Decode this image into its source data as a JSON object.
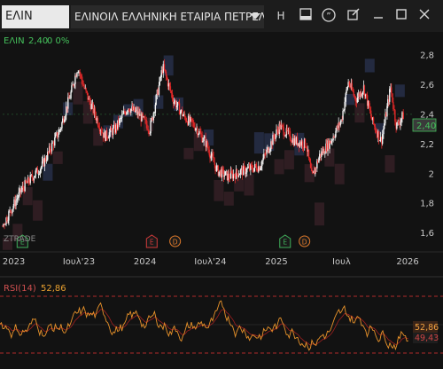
{
  "toolbar": {
    "symbol": "ΕΛΙΝ",
    "company_name": "ΕΛΙΝΟΙΛ ΕΛΛΗΝΙΚΗ ΕΤΑΙΡΙΑ ΠΕΤΡΕΛΑΙΩ",
    "h_label": "H"
  },
  "price_panel": {
    "legend_symbol": "ΕΛΙΝ",
    "legend_value": "2,40",
    "legend_change": "0 0%",
    "last_price_badge": "2,40",
    "watermark": "ZTRADE",
    "event_markers": [
      {
        "date": "2023-01-25",
        "letter": "E",
        "color": "#3fae5a"
      },
      {
        "date": "2024-01-20",
        "letter": "E",
        "color": "#d03a3a"
      },
      {
        "date": "2024-03-25",
        "letter": "D",
        "color": "#e07a2a"
      },
      {
        "date": "2025-01-25",
        "letter": "E",
        "color": "#3fae5a"
      },
      {
        "date": "2025-03-20",
        "letter": "D",
        "color": "#e07a2a"
      }
    ]
  },
  "rsi_panel": {
    "label": "RSI(14)",
    "value": "52,86",
    "badge_top": "52,86",
    "badge_bottom": "49,43",
    "upper_level": 70,
    "lower_level": 30
  },
  "chart_data": [
    {
      "type": "candlestick",
      "y_axis_ticks": [
        "2,8",
        "2,6",
        "2,4",
        "2,2",
        "2",
        "1,8",
        "1,6"
      ],
      "x_axis_ticks": [
        "2023",
        "Ιουλ'23",
        "2024",
        "Ιουλ'24",
        "2025",
        "Ιουλ",
        "2026"
      ],
      "ylim": [
        1.52,
        2.92
      ],
      "x_range": [
        "2022-12-01",
        "2025-12-22"
      ],
      "close_keypoints": [
        {
          "date": "2022-12-01",
          "value": 1.65
        },
        {
          "date": "2023-01-25",
          "value": 1.9
        },
        {
          "date": "2023-03-20",
          "value": 2.05
        },
        {
          "date": "2023-05-10",
          "value": 2.3
        },
        {
          "date": "2023-06-10",
          "value": 2.55
        },
        {
          "date": "2023-06-28",
          "value": 2.72
        },
        {
          "date": "2023-07-20",
          "value": 2.55
        },
        {
          "date": "2023-08-15",
          "value": 2.4
        },
        {
          "date": "2023-09-10",
          "value": 2.25
        },
        {
          "date": "2023-10-10",
          "value": 2.3
        },
        {
          "date": "2023-11-15",
          "value": 2.45
        },
        {
          "date": "2023-12-15",
          "value": 2.4
        },
        {
          "date": "2024-01-15",
          "value": 2.3
        },
        {
          "date": "2024-02-20",
          "value": 2.72
        },
        {
          "date": "2024-03-20",
          "value": 2.5
        },
        {
          "date": "2024-04-20",
          "value": 2.38
        },
        {
          "date": "2024-05-20",
          "value": 2.32
        },
        {
          "date": "2024-06-20",
          "value": 2.2
        },
        {
          "date": "2024-07-20",
          "value": 2.02
        },
        {
          "date": "2024-08-20",
          "value": 1.98
        },
        {
          "date": "2024-10-01",
          "value": 2.02
        },
        {
          "date": "2024-11-15",
          "value": 2.05
        },
        {
          "date": "2025-01-10",
          "value": 2.32
        },
        {
          "date": "2025-02-20",
          "value": 2.22
        },
        {
          "date": "2025-03-25",
          "value": 2.2
        },
        {
          "date": "2025-04-10",
          "value": 1.97
        },
        {
          "date": "2025-05-01",
          "value": 2.12
        },
        {
          "date": "2025-06-01",
          "value": 2.22
        },
        {
          "date": "2025-07-01",
          "value": 2.36
        },
        {
          "date": "2025-07-20",
          "value": 2.62
        },
        {
          "date": "2025-08-10",
          "value": 2.5
        },
        {
          "date": "2025-09-01",
          "value": 2.58
        },
        {
          "date": "2025-09-25",
          "value": 2.35
        },
        {
          "date": "2025-10-20",
          "value": 2.22
        },
        {
          "date": "2025-11-15",
          "value": 2.58
        },
        {
          "date": "2025-12-01",
          "value": 2.32
        },
        {
          "date": "2025-12-22",
          "value": 2.4
        }
      ],
      "grid": false,
      "last_value": 2.4
    },
    {
      "type": "line",
      "name": "RSI(14)",
      "ylim": [
        20,
        80
      ],
      "reference_lines": [
        70,
        30
      ],
      "last_values": [
        52.86,
        49.43
      ]
    }
  ]
}
